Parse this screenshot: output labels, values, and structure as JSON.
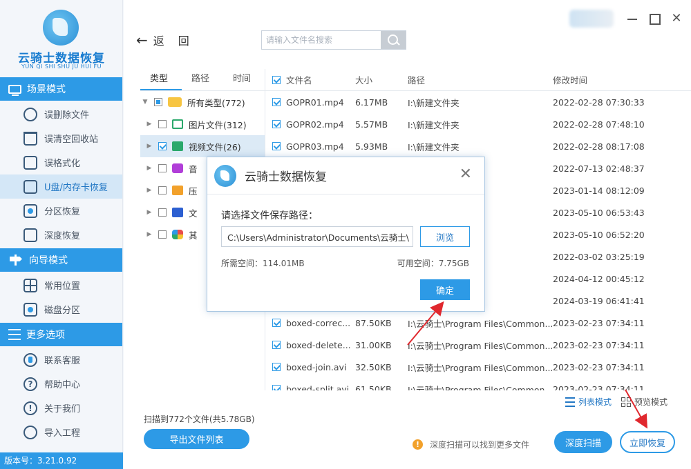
{
  "app": {
    "logo_name": "云骑士数据恢复",
    "logo_sub": "YUN QI SHI SHU JU HUI FU",
    "version": "版本号：3.21.0.92"
  },
  "sidebar": {
    "sections": [
      {
        "title": "场景模式",
        "icon": "monitor-icon",
        "items": [
          {
            "label": "误删除文件",
            "icon": "recover-file-icon"
          },
          {
            "label": "误清空回收站",
            "icon": "recycle-bin-icon"
          },
          {
            "label": "误格式化",
            "icon": "format-icon"
          },
          {
            "label": "U盘/内存卡恢复",
            "icon": "sd-card-icon"
          },
          {
            "label": "分区恢复",
            "icon": "partition-disk-icon"
          },
          {
            "label": "深度恢复",
            "icon": "deep-recover-icon"
          }
        ]
      },
      {
        "title": "向导模式",
        "icon": "signpost-icon",
        "items": [
          {
            "label": "常用位置",
            "icon": "windows-icon"
          },
          {
            "label": "磁盘分区",
            "icon": "disk-icon"
          }
        ]
      },
      {
        "title": "更多选项",
        "icon": "menu-icon",
        "items": [
          {
            "label": "联系客服",
            "icon": "phone-icon"
          },
          {
            "label": "帮助中心",
            "icon": "help-icon"
          },
          {
            "label": "关于我们",
            "icon": "info-icon"
          },
          {
            "label": "导入工程",
            "icon": "import-icon"
          }
        ]
      }
    ],
    "active_item": "U盘/内存卡恢复"
  },
  "header": {
    "back_label": "返回",
    "search_placeholder": "请输入文件名搜索"
  },
  "tree": {
    "tabs": [
      "类型",
      "路径",
      "时间"
    ],
    "active_tab": "类型",
    "root": "所有类型(772)",
    "children": [
      {
        "label": "图片文件(312)",
        "icon": "image-icon",
        "checked": false
      },
      {
        "label": "视频文件(26)",
        "icon": "video-icon",
        "checked": true
      },
      {
        "label": "音",
        "icon": "music-icon",
        "checked": false
      },
      {
        "label": "压",
        "icon": "zip-icon",
        "checked": false
      },
      {
        "label": "文",
        "icon": "document-icon",
        "checked": false
      },
      {
        "label": "其",
        "icon": "other-icon",
        "checked": false
      }
    ]
  },
  "table": {
    "headers": [
      "文件名",
      "大小",
      "路径",
      "修改时间"
    ],
    "rows": [
      {
        "name": "GOPR01.mp4",
        "size": "6.17MB",
        "path": "I:\\新建文件夹",
        "time": "2022-02-28 07:30:33"
      },
      {
        "name": "GOPR02.mp4",
        "size": "5.57MB",
        "path": "I:\\新建文件夹",
        "time": "2022-02-28 07:48:10"
      },
      {
        "name": "GOPR03.mp4",
        "size": "5.93MB",
        "path": "I:\\新建文件夹",
        "time": "2022-02-28 08:17:08"
      },
      {
        "name": "",
        "size": "",
        "path": "",
        "time": "2022-07-13 02:48:37"
      },
      {
        "name": "",
        "size": "",
        "path": "",
        "time": "2023-01-14 08:12:09"
      },
      {
        "name": "",
        "size": "",
        "path": "",
        "time": "2023-05-10 06:53:43"
      },
      {
        "name": "",
        "size": "",
        "path": "",
        "time": "2023-05-10 06:52:20"
      },
      {
        "name": "",
        "size": "",
        "path": "",
        "time": "2022-03-02 03:25:19"
      },
      {
        "name": "",
        "size": "",
        "path": "dministrator\\D...",
        "time": "2024-04-12 00:45:12"
      },
      {
        "name": "",
        "size": "",
        "path": "",
        "time": "2024-03-19 06:41:41"
      },
      {
        "name": "boxed-correc...",
        "size": "87.50KB",
        "path": "I:\\云骑士\\Program Files\\Common...",
        "time": "2023-02-23 07:34:11"
      },
      {
        "name": "boxed-delete...",
        "size": "31.00KB",
        "path": "I:\\云骑士\\Program Files\\Common...",
        "time": "2023-02-23 07:34:11"
      },
      {
        "name": "boxed-join.avi",
        "size": "32.50KB",
        "path": "I:\\云骑士\\Program Files\\Common...",
        "time": "2023-02-23 07:34:11"
      },
      {
        "name": "boxed-split.avi",
        "size": "61.50KB",
        "path": "I:\\云骑士\\Program Files\\Common...",
        "time": "2023-02-23 07:34:11"
      }
    ]
  },
  "footer": {
    "view_list": "列表模式",
    "view_preview": "预览模式",
    "scan_summary": "扫描到772个文件(共5.78GB)",
    "export_label": "导出文件列表",
    "deep_hint": "深度扫描可以找到更多文件",
    "deep_scan_label": "深度扫描",
    "recover_label": "立即恢复"
  },
  "dialog": {
    "title": "云骑士数据恢复",
    "prompt": "请选择文件保存路径：",
    "path_value": "C:\\Users\\Administrator\\Documents\\云骑士\\",
    "browse_label": "浏览",
    "required_space": "所需空间：114.01MB",
    "available_space": "可用空间：7.75GB",
    "ok_label": "确定"
  },
  "colors": {
    "accent": "#2d9ae6",
    "annotation_arrow": "#e0282e"
  }
}
